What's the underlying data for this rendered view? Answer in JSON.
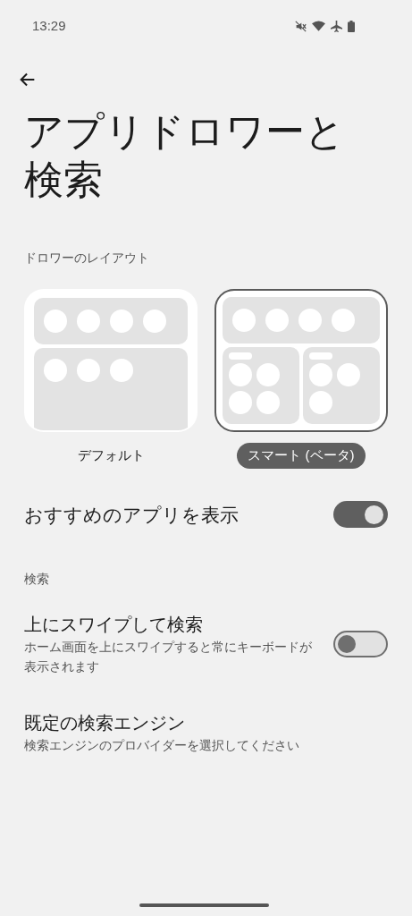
{
  "status_bar": {
    "time": "13:29"
  },
  "title": "アプリドロワーと検索",
  "layout_section": {
    "header": "ドロワーのレイアウト",
    "options": [
      {
        "kind": "default",
        "label": "デフォルト",
        "selected": false
      },
      {
        "kind": "smart",
        "label": "スマート (ベータ)",
        "selected": true
      }
    ]
  },
  "suggested_apps": {
    "label": "おすすめのアプリを表示",
    "on": true
  },
  "search_section": {
    "header": "検索",
    "items": [
      {
        "kind": "toggle",
        "title": "上にスワイプして検索",
        "subtitle": "ホーム画面を上にスワイプすると常にキーボードが表示されます",
        "on": false
      },
      {
        "kind": "link",
        "title": "既定の検索エンジン",
        "subtitle": "検索エンジンのプロバイダーを選択してください"
      }
    ]
  }
}
